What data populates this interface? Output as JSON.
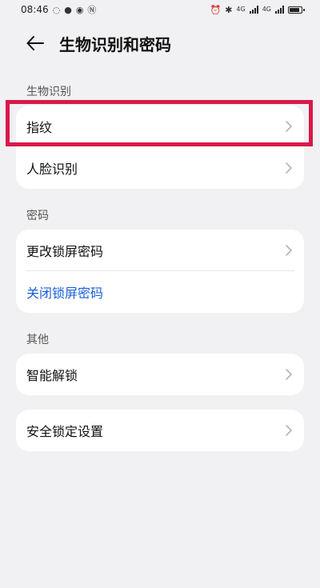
{
  "status": {
    "time": "08:46",
    "net1": "4G",
    "net2": "4G",
    "battery_level": 0.85
  },
  "header": {
    "title": "生物识别和密码"
  },
  "sections": {
    "biometrics": {
      "label": "生物识别",
      "items": [
        {
          "label": "指纹"
        },
        {
          "label": "人脸识别"
        }
      ]
    },
    "password": {
      "label": "密码",
      "items": [
        {
          "label": "更改锁屏密码"
        },
        {
          "label": "关闭锁屏密码"
        }
      ]
    },
    "other": {
      "label": "其他",
      "items": [
        {
          "label": "智能解锁"
        }
      ]
    },
    "security": {
      "items": [
        {
          "label": "安全锁定设置"
        }
      ]
    }
  },
  "colors": {
    "background": "#f1f1f3",
    "link": "#1a5fd6",
    "highlight": "#d9184a"
  }
}
